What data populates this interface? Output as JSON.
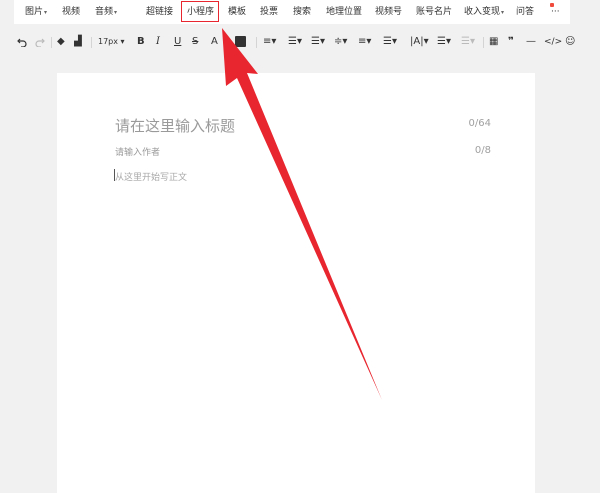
{
  "menu": {
    "items": [
      {
        "label": "图片",
        "caret": true
      },
      {
        "label": "视频",
        "caret": false
      },
      {
        "label": "音频",
        "caret": true
      },
      {
        "label": "超链接",
        "caret": false
      },
      {
        "label": "小程序",
        "caret": false
      },
      {
        "label": "模板",
        "caret": false
      },
      {
        "label": "投票",
        "caret": false
      },
      {
        "label": "搜索",
        "caret": false
      },
      {
        "label": "地理位置",
        "caret": false
      },
      {
        "label": "视频号",
        "caret": false
      },
      {
        "label": "账号名片",
        "caret": false
      },
      {
        "label": "收入变现",
        "caret": true
      },
      {
        "label": "问答",
        "caret": false
      },
      {
        "label": "···",
        "caret": false
      }
    ],
    "highlighted_item": "小程序",
    "highlight_color": "#e8262f"
  },
  "toolbar": {
    "undo_icon": "undo-icon",
    "redo_icon": "redo-icon",
    "font_size": "17px",
    "bold": "B",
    "italic": "I",
    "underline": "U",
    "strike": "S",
    "font_color": "A",
    "quote": "❞",
    "hr": "—",
    "code": "</>",
    "emoji_icon": "emoji-icon"
  },
  "editor": {
    "title_placeholder": "请在这里输入标题",
    "title_count": "0/64",
    "author_placeholder": "请输入作者",
    "author_count": "0/8",
    "body_placeholder": "从这里开始写正文"
  },
  "annotation": {
    "arrow_color": "#e8262f"
  }
}
